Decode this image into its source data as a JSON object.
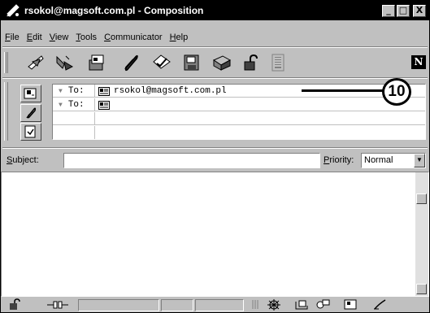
{
  "window": {
    "title": "rsokol@magsoft.com.pl - Composition",
    "minimize": "_",
    "maximize": "□",
    "close": "X"
  },
  "menu": {
    "items": [
      {
        "label": "File",
        "accel": "F",
        "rest": "ile"
      },
      {
        "label": "Edit",
        "accel": "E",
        "rest": "dit"
      },
      {
        "label": "View",
        "accel": "V",
        "rest": "iew"
      },
      {
        "label": "Tools",
        "accel": "T",
        "rest": "ools"
      },
      {
        "label": "Communicator",
        "accel": "C",
        "rest": "ommunicator"
      },
      {
        "label": "Help",
        "accel": "H",
        "rest": "elp"
      }
    ]
  },
  "toolbar": {
    "buttons": [
      "send-icon",
      "quote-icon",
      "address-icon",
      "attach-icon",
      "spelling-icon",
      "save-icon",
      "print-icon",
      "security-icon",
      "stop-icon"
    ],
    "logo": "N"
  },
  "addressing": {
    "rows": [
      {
        "type": "To:",
        "value": "rsokol@magsoft.com.pl"
      },
      {
        "type": "To:",
        "value": ""
      }
    ],
    "callout": "10"
  },
  "subject": {
    "label_accel": "S",
    "label_rest": "ubject:",
    "value": ""
  },
  "priority": {
    "label_accel": "P",
    "label_rest": "riority:",
    "value": "Normal"
  },
  "colors": {
    "title_bg": "#000000",
    "chrome": "#c0c0c0"
  }
}
